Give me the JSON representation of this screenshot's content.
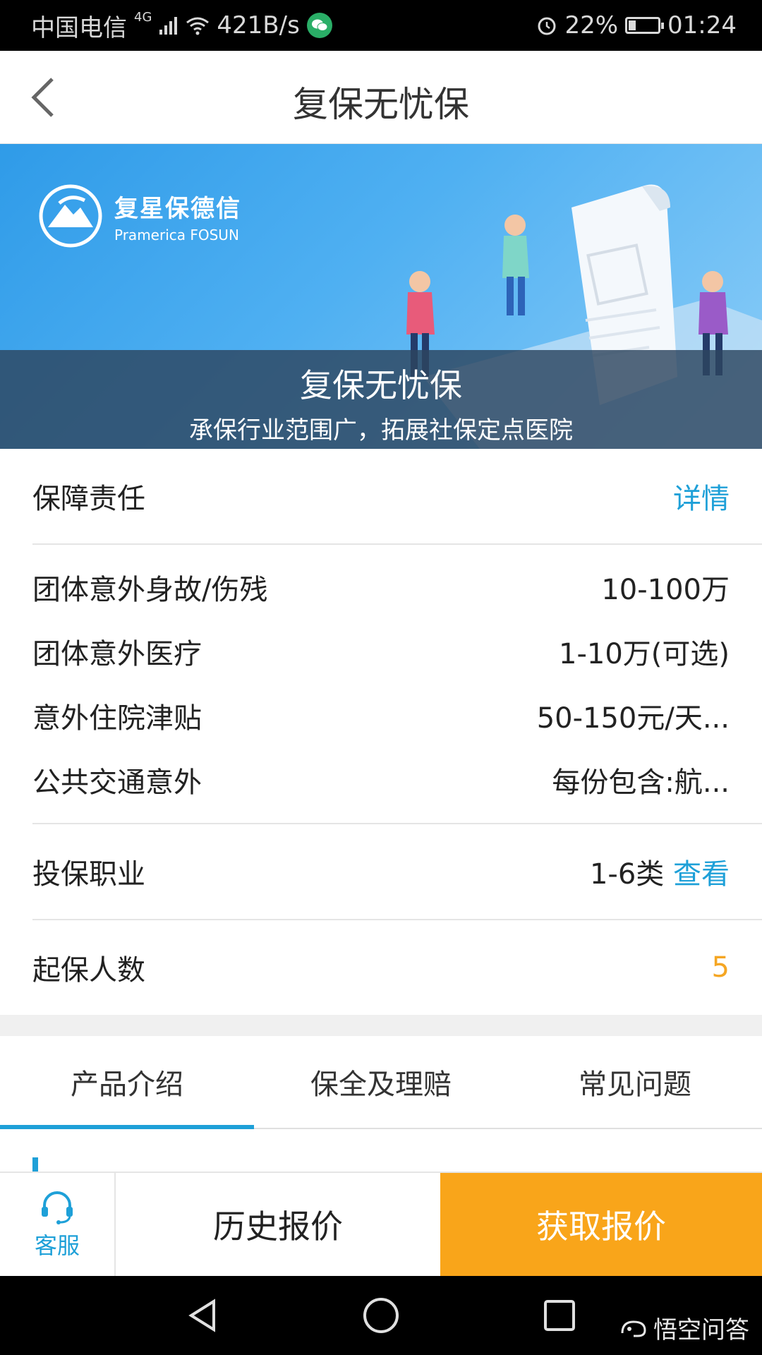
{
  "status_bar": {
    "carrier": "中国电信",
    "network_type": "4G",
    "speed": "421B/s",
    "battery": "22%",
    "battery_level": 0.22,
    "time": "01:24",
    "icons": [
      "signal-icon",
      "wifi-icon",
      "wechat-icon",
      "alarm-icon",
      "battery-icon"
    ]
  },
  "header": {
    "title": "复保无忧保",
    "back_icon": "back-arrow-icon"
  },
  "banner": {
    "brand_cn": "复星保德信",
    "brand_en": "Pramerica FOSUN",
    "title": "复保无忧保",
    "subtitle": "承保行业范围广，拓展社保定点医院",
    "gradient_colors": [
      "#2f9be8",
      "#8ccdf7"
    ]
  },
  "coverage": {
    "label": "保障责任",
    "link": "详情",
    "items": [
      {
        "label": "团体意外身故/伤残",
        "value": "10-100万"
      },
      {
        "label": "团体意外医疗",
        "value": "1-10万(可选)"
      },
      {
        "label": "意外住院津贴",
        "value": "50-150元/天..."
      },
      {
        "label": "公共交通意外",
        "value": "每份包含:航..."
      }
    ]
  },
  "occupation": {
    "label": "投保职业",
    "value": "1-6类",
    "link": "查看"
  },
  "min_insured": {
    "label": "起保人数",
    "value": "5"
  },
  "tabs": [
    {
      "label": "产品介绍",
      "active": true
    },
    {
      "label": "保全及理赔",
      "active": false
    },
    {
      "label": "常见问题",
      "active": false
    }
  ],
  "actions": {
    "service_label": "客服",
    "history_label": "历史报价",
    "quote_label": "获取报价"
  },
  "watermark": "悟空问答",
  "colors": {
    "accent_blue": "#1ea0d8",
    "orange": "#f9a51a",
    "value_orange": "#f5a623"
  }
}
